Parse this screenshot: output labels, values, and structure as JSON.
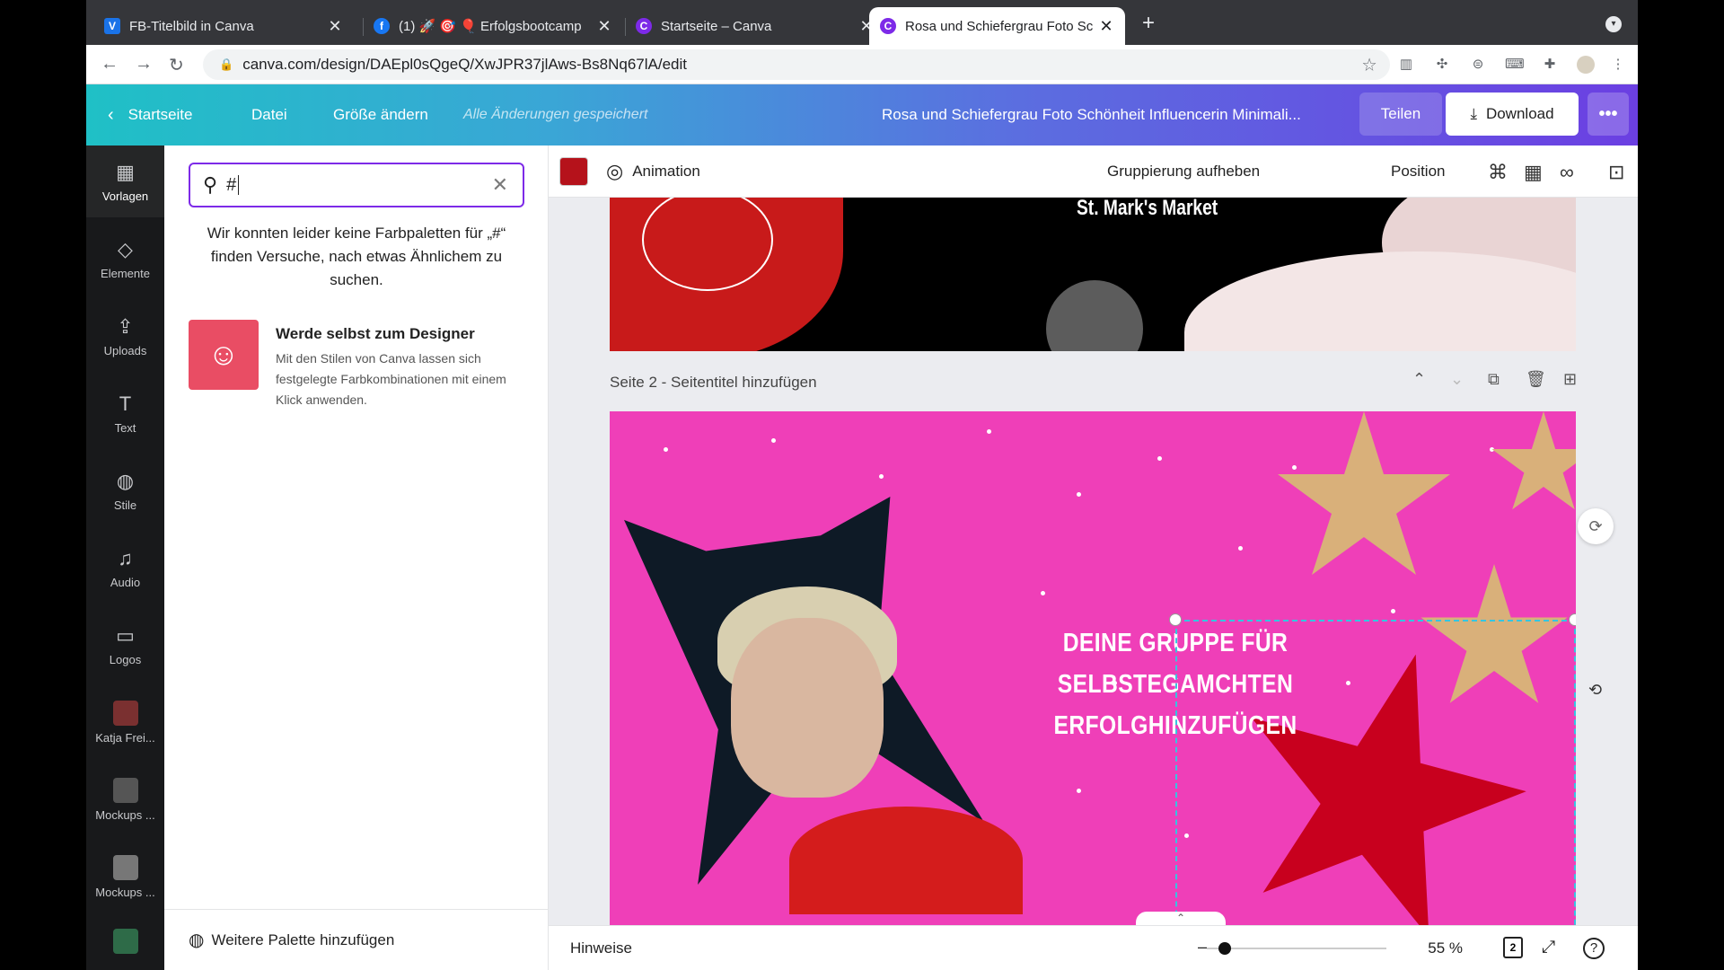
{
  "browser": {
    "tabs": [
      {
        "title": "FB-Titelbild in Canva",
        "fav": "V",
        "favcolor": "#1a73e8"
      },
      {
        "title": "(1) 🚀 🎯 🎈 Erfolgsbootcamp",
        "fav": "f",
        "favcolor": "#1877f2"
      },
      {
        "title": "Startseite – Canva",
        "fav": "C",
        "favcolor": "#7d2ae8"
      },
      {
        "title": "Rosa und Schiefergrau Foto Sc",
        "fav": "C",
        "favcolor": "#7d2ae8"
      }
    ],
    "url": "canva.com/design/DAEpl0sQgeQ/XwJPR37jlAws-Bs8Nq67lA/edit"
  },
  "header": {
    "back_label": "Startseite",
    "file_label": "Datei",
    "resize_label": "Größe ändern",
    "saved_label": "Alle Änderungen gespeichert",
    "doc_title": "Rosa und Schiefergrau Foto Schönheit Influencerin Minimali...",
    "share_label": "Teilen",
    "download_label": "Download"
  },
  "rail": [
    {
      "label": "Vorlagen",
      "icon": "▦"
    },
    {
      "label": "Elemente",
      "icon": "◇"
    },
    {
      "label": "Uploads",
      "icon": "⇪"
    },
    {
      "label": "Text",
      "icon": "T"
    },
    {
      "label": "Stile",
      "icon": "◍"
    },
    {
      "label": "Audio",
      "icon": "♫"
    },
    {
      "label": "Logos",
      "icon": "▭"
    },
    {
      "label": "Katja Frei...",
      "icon": ""
    },
    {
      "label": "Mockups ...",
      "icon": ""
    },
    {
      "label": "Mockups ...",
      "icon": ""
    }
  ],
  "panel": {
    "search_value": "#",
    "no_results": "Wir konnten leider keine Farbpaletten für „#“ finden Versuche, nach etwas Ähnlichem zu suchen.",
    "promo_title": "Werde selbst zum Designer",
    "promo_desc": "Mit den Stilen von Canva lassen sich festgelegte Farbkombinationen mit einem Klick anwenden.",
    "footer_label": "Weitere Palette hinzufügen"
  },
  "toolbar": {
    "color": "#b5121b",
    "animation_label": "Animation",
    "ungroup_label": "Gruppierung aufheben",
    "position_label": "Position"
  },
  "canvas": {
    "page1_text": "St. Mark's Market",
    "page2_label": "Seite 2 - Seitentitel hinzufügen",
    "page2_text_line1": "DEINE GRUPPE FÜR",
    "page2_text_line2": "SELBSTEGAMCHTEN ERFOLGHINZUFÜGEN",
    "page_bg": "#ef3fb8"
  },
  "bottombar": {
    "notes_label": "Hinweise",
    "zoom": "55 %",
    "zoom_level": 0.1,
    "page_count": "2"
  }
}
